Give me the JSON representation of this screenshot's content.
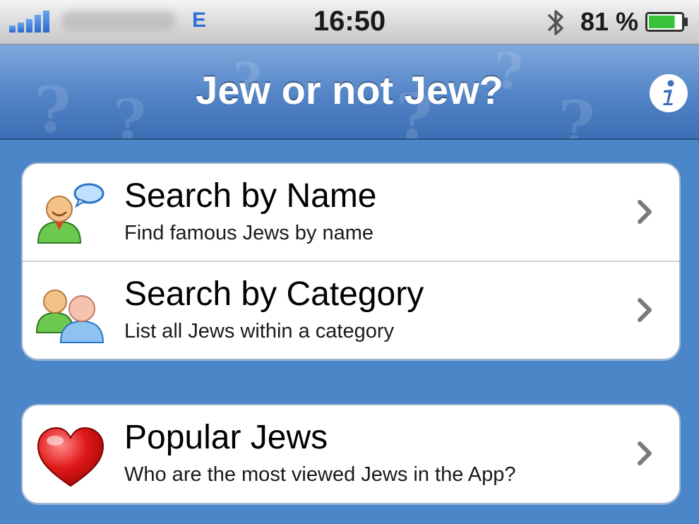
{
  "status_bar": {
    "network": "E",
    "time": "16:50",
    "battery_percent": "81 %",
    "battery_level": 0.81,
    "signal_bars": 5
  },
  "nav": {
    "title": "Jew or not Jew?",
    "info_icon": "info-icon"
  },
  "menu": {
    "search_by_name": {
      "title": "Search by Name",
      "subtitle": "Find famous Jews by name",
      "icon": "person-speech-bubble-icon"
    },
    "search_by_category": {
      "title": "Search by Category",
      "subtitle": "List all Jews within a category",
      "icon": "group-people-icon"
    },
    "popular": {
      "title": "Popular Jews",
      "subtitle": "Who are the most viewed Jews in the App?",
      "icon": "heart-icon"
    }
  },
  "colors": {
    "background": "#4a86c8",
    "navbar": "#5283c6",
    "network_indicator": "#2f6fd8",
    "battery_fill": "#3bc23b"
  }
}
